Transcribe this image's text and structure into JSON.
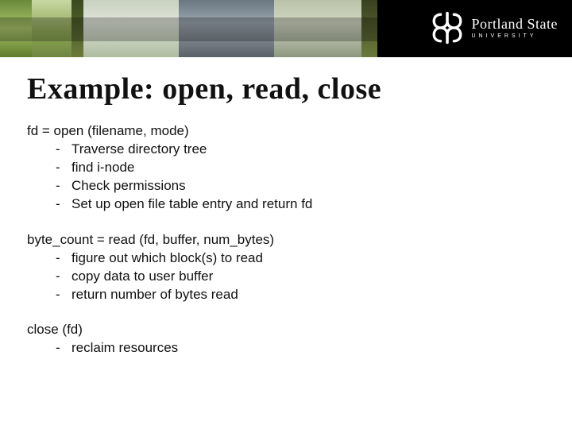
{
  "banner": {
    "logo_line1": "Portland State",
    "logo_line2": "UNIVERSITY"
  },
  "slide": {
    "title": "Example: open, read, close",
    "sections": [
      {
        "call": "fd = open (filename, mode)",
        "steps": [
          "Traverse directory tree",
          "find i-node",
          "Check permissions",
          "Set up open file table entry and return fd"
        ]
      },
      {
        "call": "byte_count = read (fd, buffer, num_bytes)",
        "steps": [
          "figure out which block(s) to read",
          "copy data to user buffer",
          "return number of bytes read"
        ]
      },
      {
        "call": "close (fd)",
        "steps": [
          "reclaim resources"
        ]
      }
    ]
  }
}
